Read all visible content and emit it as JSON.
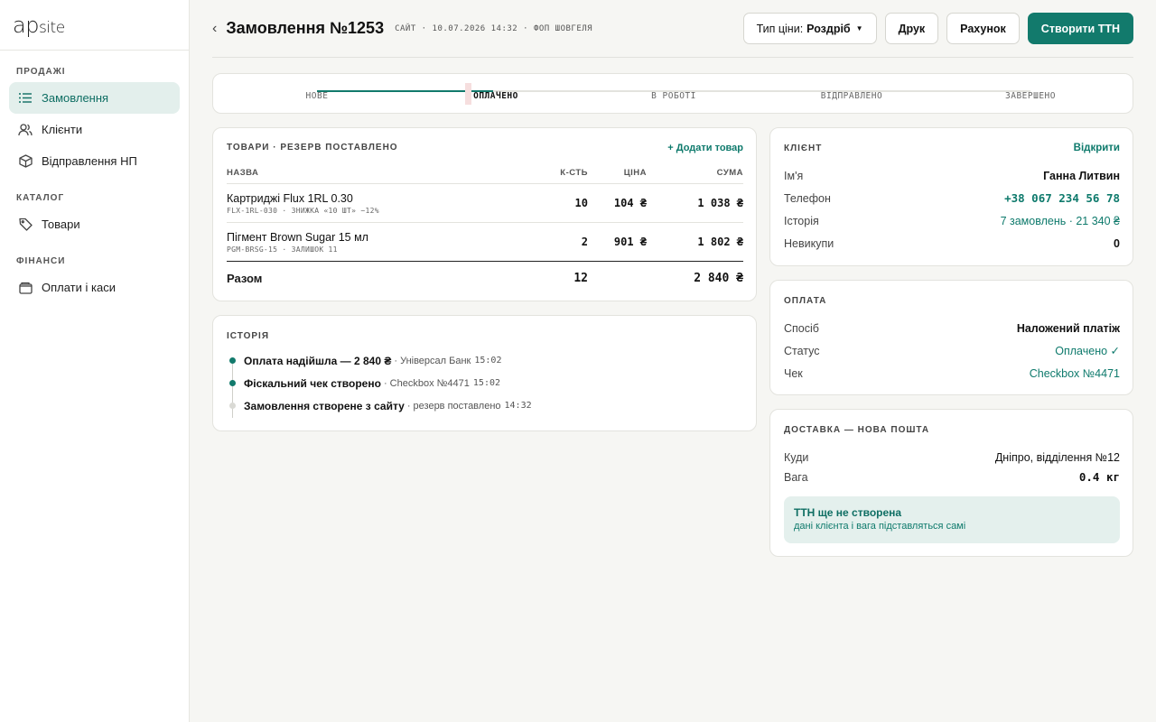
{
  "brand": {
    "logo_main": "ap",
    "logo_small": "site"
  },
  "sidebar": {
    "sections": [
      {
        "label": "ПРОДАЖІ",
        "items": [
          {
            "label": "Замовлення",
            "icon": "list-icon",
            "active": true
          },
          {
            "label": "Клієнти",
            "icon": "users-icon",
            "active": false
          },
          {
            "label": "Відправлення НП",
            "icon": "package-icon",
            "active": false
          }
        ]
      },
      {
        "label": "КАТАЛОГ",
        "items": [
          {
            "label": "Товари",
            "icon": "tag-icon",
            "active": false
          }
        ]
      },
      {
        "label": "ФІНАНСИ",
        "items": [
          {
            "label": "Оплати і каси",
            "icon": "wallet-icon",
            "active": false
          }
        ]
      }
    ]
  },
  "header": {
    "back": "‹",
    "title": "Замовлення №1253",
    "meta": "САЙТ · 10.07.2026 14:32 · ФОП ШОВГЕЛЯ",
    "price_type_label": "Тип ціни:",
    "price_type_value": "Роздріб",
    "print_label": "Друк",
    "invoice_label": "Рахунок",
    "create_ttn_label": "Створити ТТН"
  },
  "tracker": {
    "steps": [
      "НОВЕ",
      "ОПЛАЧЕНО",
      "В РОБОТІ",
      "ВІДПРАВЛЕНО",
      "ЗАВЕРШЕНО"
    ],
    "current_index": 1
  },
  "goods": {
    "title": "ТОВАРИ · РЕЗЕРВ ПОСТАВЛЕНО",
    "add_label": "+ Додати товар",
    "columns": {
      "name": "НАЗВА",
      "qty": "К-СТЬ",
      "price": "ЦІНА",
      "sum": "СУМА"
    },
    "rows": [
      {
        "name": "Картриджі Flux 1RL 0.30",
        "sub": "FLX-1RL-030 · ЗНИЖКА «10 ШТ» −12%",
        "qty": "10",
        "price": "104 ₴",
        "sum": "1 038 ₴"
      },
      {
        "name": "Пігмент Brown Sugar 15 мл",
        "sub": "PGM-BRSG-15 · ЗАЛИШОК 11",
        "qty": "2",
        "price": "901 ₴",
        "sum": "1 802 ₴"
      }
    ],
    "total": {
      "label": "Разом",
      "qty": "12",
      "sum": "2 840 ₴"
    }
  },
  "history": {
    "title": "ІСТОРІЯ",
    "items": [
      {
        "strong": "Оплата надійшла — 2 840 ₴",
        "rest": "· Універсал Банк",
        "time": "15:02",
        "done": true
      },
      {
        "strong": "Фіскальний чек створено",
        "rest": "· Checkbox №4471",
        "time": "15:02",
        "done": true
      },
      {
        "strong": "Замовлення створене з сайту",
        "rest": "· резерв поставлено",
        "time": "14:32",
        "done": false
      }
    ]
  },
  "client": {
    "title": "КЛІЄНТ",
    "open_label": "Відкрити",
    "name_k": "Ім'я",
    "name_v": "Ганна Литвин",
    "phone_k": "Телефон",
    "phone_v": "+38 067 234 56 78",
    "history_k": "Історія",
    "history_v": "7 замовлень · 21 340 ₴",
    "refused_k": "Невикупи",
    "refused_v": "0"
  },
  "payment": {
    "title": "ОПЛАТА",
    "method_k": "Спосіб",
    "method_v": "Наложений платіж",
    "status_k": "Статус",
    "status_v": "Оплачено ✓",
    "receipt_k": "Чек",
    "receipt_v": "Checkbox №4471"
  },
  "delivery": {
    "title": "ДОСТАВКА — НОВА ПОШТА",
    "to_k": "Куди",
    "to_v": "Дніпро, відділення №12",
    "weight_k": "Вага",
    "weight_v": "0.4 кг",
    "note_title": "ТТН ще не створена",
    "note_text": "дані клієнта і вага підставляться самі"
  },
  "colors": {
    "accent": "#127a6c",
    "accent_bg": "#e3efec",
    "page_bg": "#f6f6f3"
  }
}
